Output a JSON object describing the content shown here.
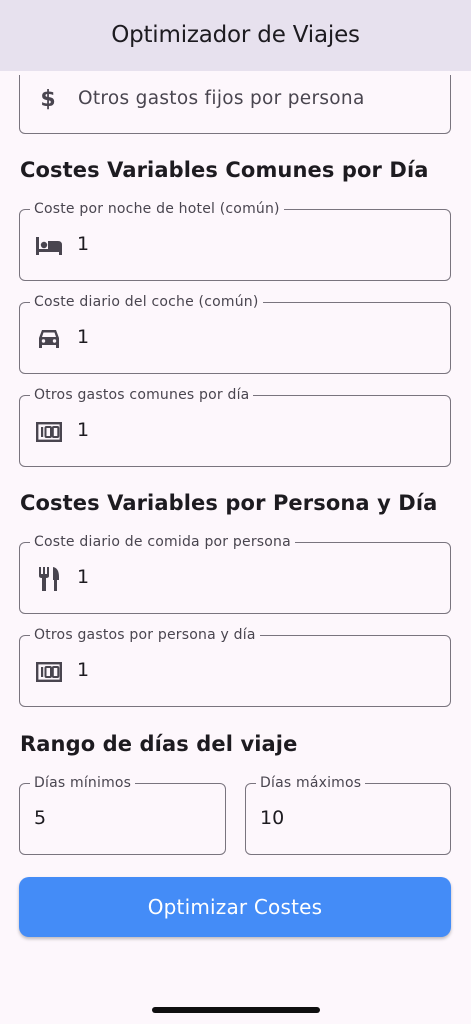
{
  "app_bar": {
    "title": "Optimizador de Viajes"
  },
  "fixed_costs": {
    "other_fixed_per_person": {
      "placeholder": "Otros gastos fijos por persona",
      "icon": "dollar-icon"
    }
  },
  "common_daily": {
    "title": "Costes Variables Comunes por Día",
    "hotel": {
      "label": "Coste por noche de hotel (común)",
      "value": "1",
      "icon": "hotel-bed-icon"
    },
    "car": {
      "label": "Coste diario del coche (común)",
      "value": "1",
      "icon": "car-icon"
    },
    "other": {
      "label": "Otros gastos comunes por día",
      "value": "1",
      "icon": "hundred-icon"
    }
  },
  "per_person_daily": {
    "title": "Costes Variables por Persona y Día",
    "food": {
      "label": "Coste diario de comida por persona",
      "value": "1",
      "icon": "restaurant-icon"
    },
    "other": {
      "label": "Otros gastos por persona y día",
      "value": "1",
      "icon": "hundred-icon"
    }
  },
  "day_range": {
    "title": "Rango de días del viaje",
    "min": {
      "label": "Días mínimos",
      "value": "5"
    },
    "max": {
      "label": "Días máximos",
      "value": "10"
    }
  },
  "actions": {
    "optimize_label": "Optimizar Costes"
  },
  "colors": {
    "app_bar_bg": "#e7e1ee",
    "page_bg": "#fdf7fc",
    "button_bg": "#448cf7",
    "outline": "#79747e"
  }
}
